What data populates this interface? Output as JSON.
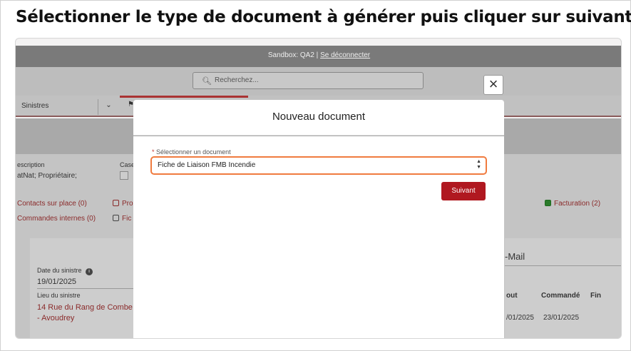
{
  "instruction": "Sélectionner le type de document à générer puis cliquer sur suivant",
  "topbar": {
    "sandbox": "Sandbox: QA2 |",
    "logout": "Se déconnecter"
  },
  "search": {
    "placeholder": "Recherchez..."
  },
  "nav": {
    "sinistres": "Sinistres"
  },
  "detail": {
    "description_label": "escription",
    "description_value": "atNat; Propriétaire;",
    "case_label": "Case",
    "contacts": "Contacts sur place (0)",
    "commandes": "Commandes internes (0)",
    "pro": "Pro",
    "fic": "Fic",
    "facturation": "Facturation (2)",
    "date_label": "Date du sinistre",
    "date_value": "19/01/2025",
    "lieu_label": "Lieu du sinistre",
    "lieu_line1": "14 Rue du Rang de Combe",
    "lieu_line2": "- Avoudrey",
    "email_tab": "-Mail",
    "col_out": "out",
    "col_commande": "Commandé",
    "col_fin": "Fin",
    "row_date1": "/01/2025",
    "row_date2": "23/01/2025"
  },
  "modal": {
    "title": "Nouveau document",
    "field_label": "Sélectionner un document",
    "required_mark": "*",
    "selected_value": "Fiche de Liaison FMB Incendie",
    "next_button": "Suivant"
  },
  "colors": {
    "accent": "#b01820",
    "highlight": "#f07b3f"
  },
  "icons": {
    "close": "close-icon",
    "search": "search-icon",
    "info": "info-icon"
  }
}
